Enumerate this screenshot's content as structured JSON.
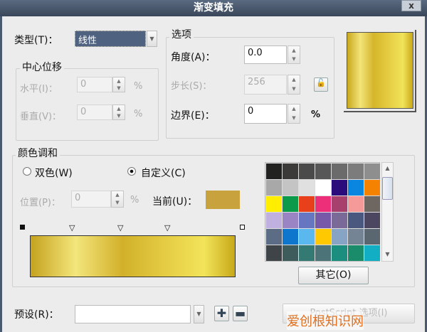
{
  "title": "渐变填充",
  "close_label": "x",
  "type": {
    "label": "类型(T)：",
    "value": "线性"
  },
  "center_offset": {
    "title": "中心位移",
    "horizontal_label": "水平(I)：",
    "horizontal_value": "0",
    "vertical_label": "垂直(V)：",
    "vertical_value": "0",
    "unit": "%"
  },
  "options": {
    "title": "选项",
    "angle_label": "角度(A)：",
    "angle_value": "0.0",
    "steps_label": "步长(S)：",
    "steps_value": "256",
    "edge_label": "边界(E)：",
    "edge_value": "0",
    "unit": "%"
  },
  "blend": {
    "title": "颜色调和",
    "two_color": "双色(W)",
    "custom": "自定义(C)",
    "selected": "custom",
    "position_label": "位置(P)：",
    "position_value": "0",
    "unit": "%",
    "current_label": "当前(U)：",
    "current_color": "#c8a23c"
  },
  "palette": [
    "#222220",
    "#3b3a39",
    "#4a4a4a",
    "#575757",
    "#6b6b6b",
    "#7c7c7c",
    "#8e8e8e",
    "#a8a8a8",
    "#c4c4c4",
    "#e0e0e0",
    "#ffffff",
    "#2a0d7a",
    "#0b86e0",
    "#f58200",
    "#ffee00",
    "#0a9a4a",
    "#e8401a",
    "#ec2f78",
    "#a8406e",
    "#f59a98",
    "#6e6660",
    "#bfb0e0",
    "#9a84c4",
    "#6676c0",
    "#7858a8",
    "#7a6a98",
    "#4a5880",
    "#4c4660",
    "#5c6c84",
    "#0e76cc",
    "#5ab8ee",
    "#ffc800",
    "#88a4c4",
    "#748494",
    "#5a6670",
    "#3e4448",
    "#3e5c5c",
    "#357a72",
    "#4c7478",
    "#1c8e80",
    "#1a8c6a",
    "#12aec4"
  ],
  "other_button": "其它(O)",
  "preset": {
    "label": "预设(R)：",
    "value": ""
  },
  "postscript_button": "PostScript 选项(I)",
  "watermark": "爱创根知识网"
}
